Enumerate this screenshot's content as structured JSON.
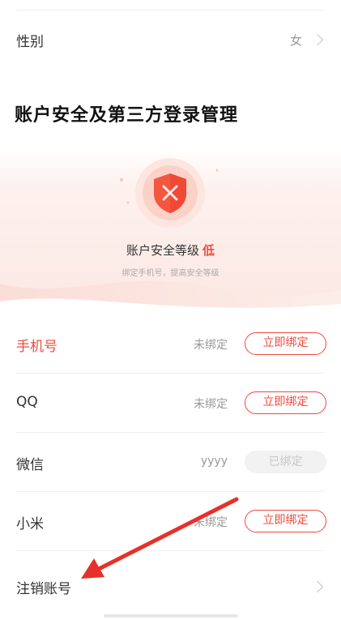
{
  "profile": {
    "gender_label": "性别",
    "gender_value": "女"
  },
  "security": {
    "section_title": "账户安全及第三方登录管理",
    "level_label": "账户安全等级",
    "level_value": "低",
    "hint": "绑定手机号，提高安全等级"
  },
  "bindings": [
    {
      "label": "手机号",
      "status": "未绑定",
      "button": "立即绑定"
    },
    {
      "label": "QQ",
      "status": "未绑定",
      "button": "立即绑定"
    },
    {
      "label": "微信",
      "status": "yyyy",
      "button": "已绑定"
    },
    {
      "label": "小米",
      "status": "未绑定",
      "button": "立即绑定"
    }
  ],
  "cancel_account": {
    "label": "注销账号"
  },
  "colors": {
    "accent": "#ef4b3f",
    "annotation_arrow": "#e8302a"
  },
  "icons": {
    "shield": "shield-x-icon",
    "chevron": "chevron-right-icon"
  }
}
